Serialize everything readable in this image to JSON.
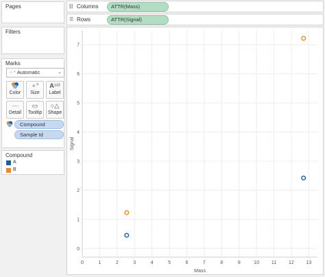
{
  "pages": {
    "title": "Pages"
  },
  "filters": {
    "title": "Filters"
  },
  "marks": {
    "title": "Marks",
    "mark_type": "Automatic",
    "buttons": [
      {
        "label": "Color",
        "icon": "color-icon"
      },
      {
        "label": "Size",
        "icon": "size-icon"
      },
      {
        "label": "Label",
        "icon": "label-icon"
      },
      {
        "label": "Detail",
        "icon": "detail-icon"
      },
      {
        "label": "Tooltip",
        "icon": "tooltip-icon"
      },
      {
        "label": "Shape",
        "icon": "shape-icon"
      }
    ],
    "pills": [
      "Compound",
      "Sample Id"
    ]
  },
  "legend": {
    "title": "Compound",
    "items": [
      {
        "label": "A",
        "color": "#1f5f9e"
      },
      {
        "label": "B",
        "color": "#e8892b"
      }
    ]
  },
  "shelves": {
    "columns": {
      "label": "Columns",
      "pill": "ATTR(Mass)"
    },
    "rows": {
      "label": "Rows",
      "pill": "ATTR(Signal)"
    }
  },
  "chart_data": {
    "type": "scatter",
    "xlabel": "Mass",
    "ylabel": "Signal",
    "xlim": [
      0,
      13.5
    ],
    "ylim": [
      -0.3,
      7.5
    ],
    "xticks": [
      0,
      1,
      2,
      3,
      4,
      5,
      6,
      7,
      8,
      9,
      10,
      11,
      12,
      13
    ],
    "yticks": [
      0,
      1,
      2,
      3,
      4,
      5,
      6,
      7
    ],
    "grid": true,
    "series": [
      {
        "name": "A",
        "color": "#1f5f9e",
        "points": [
          {
            "x": 2.55,
            "y": 0.45
          },
          {
            "x": 12.7,
            "y": 2.42
          }
        ]
      },
      {
        "name": "B",
        "color": "#e8892b",
        "points": [
          {
            "x": 2.55,
            "y": 1.23
          },
          {
            "x": 12.7,
            "y": 7.22
          }
        ]
      }
    ]
  }
}
